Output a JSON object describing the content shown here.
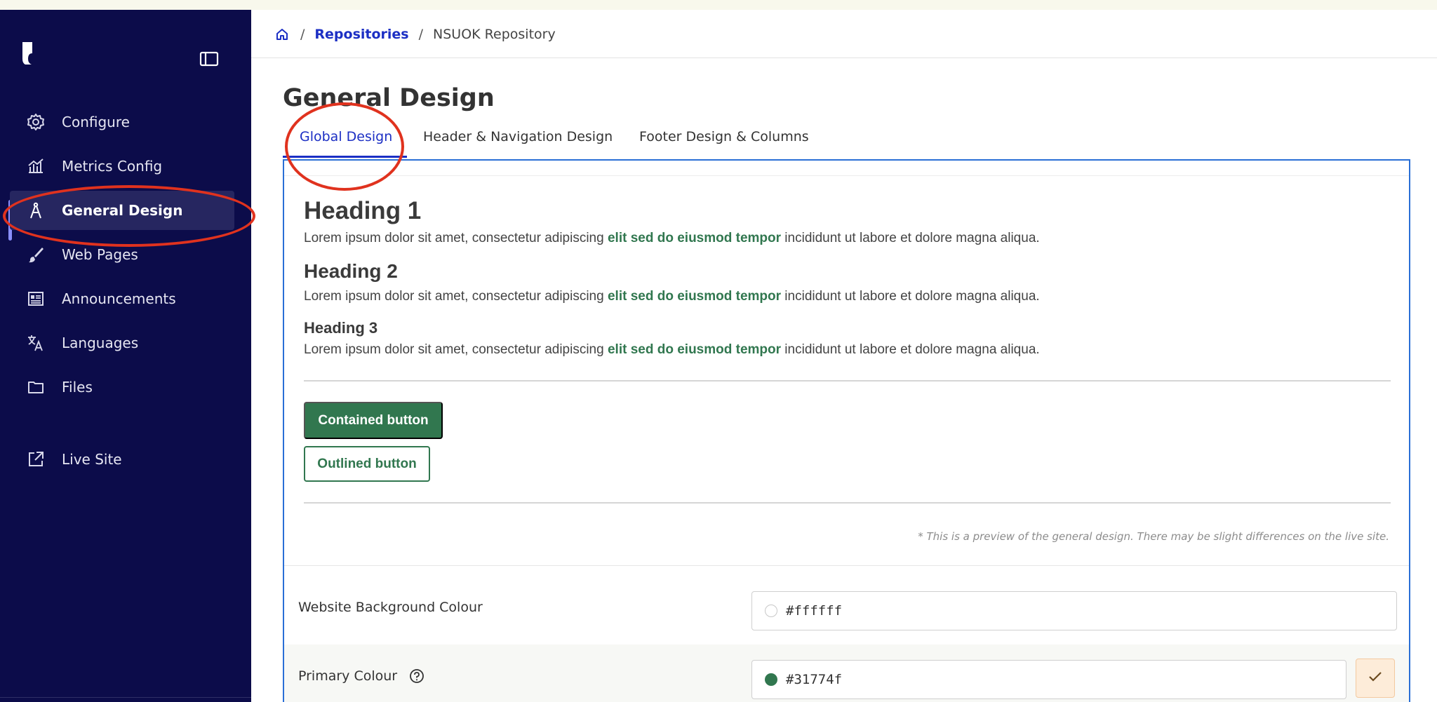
{
  "breadcrumb": {
    "home_icon": "home-icon",
    "separator": "/",
    "repositories": "Repositories",
    "current": "NSUOK Repository"
  },
  "sidebar": {
    "items": [
      {
        "label": "Configure",
        "icon": "gear-icon"
      },
      {
        "label": "Metrics Config",
        "icon": "chart-icon"
      },
      {
        "label": "General Design",
        "icon": "compass-icon",
        "active": true
      },
      {
        "label": "Web Pages",
        "icon": "brush-icon"
      },
      {
        "label": "Announcements",
        "icon": "newspaper-icon"
      },
      {
        "label": "Languages",
        "icon": "translate-icon"
      },
      {
        "label": "Files",
        "icon": "folder-icon"
      },
      {
        "label": "Live Site",
        "icon": "external-link-icon"
      }
    ]
  },
  "page": {
    "title": "General Design",
    "tabs": [
      {
        "label": "Global Design",
        "active": true
      },
      {
        "label": "Header & Navigation Design"
      },
      {
        "label": "Footer Design & Columns"
      }
    ]
  },
  "preview": {
    "heading1": "Heading 1",
    "heading2": "Heading 2",
    "heading3": "Heading 3",
    "para_start": "Lorem ipsum dolor sit amet, consectetur adipiscing ",
    "para_accent": "elit sed do eiusmod tempor",
    "para_end": " incididunt ut labore et dolore magna aliqua.",
    "contained_button": "Contained button",
    "outlined_button": "Outlined button",
    "note": "* This is a preview of the general design. There may be slight differences on the live site."
  },
  "settings": {
    "background": {
      "label": "Website Background Colour",
      "value": "#ffffff",
      "swatch": "#ffffff"
    },
    "primary": {
      "label": "Primary Colour",
      "value": "#31774f",
      "swatch": "#31774f"
    }
  },
  "colors": {
    "sidebar_bg": "#0c0c4a",
    "link": "#1c2fc4",
    "primary": "#31774f",
    "annotation": "#e0321e"
  }
}
